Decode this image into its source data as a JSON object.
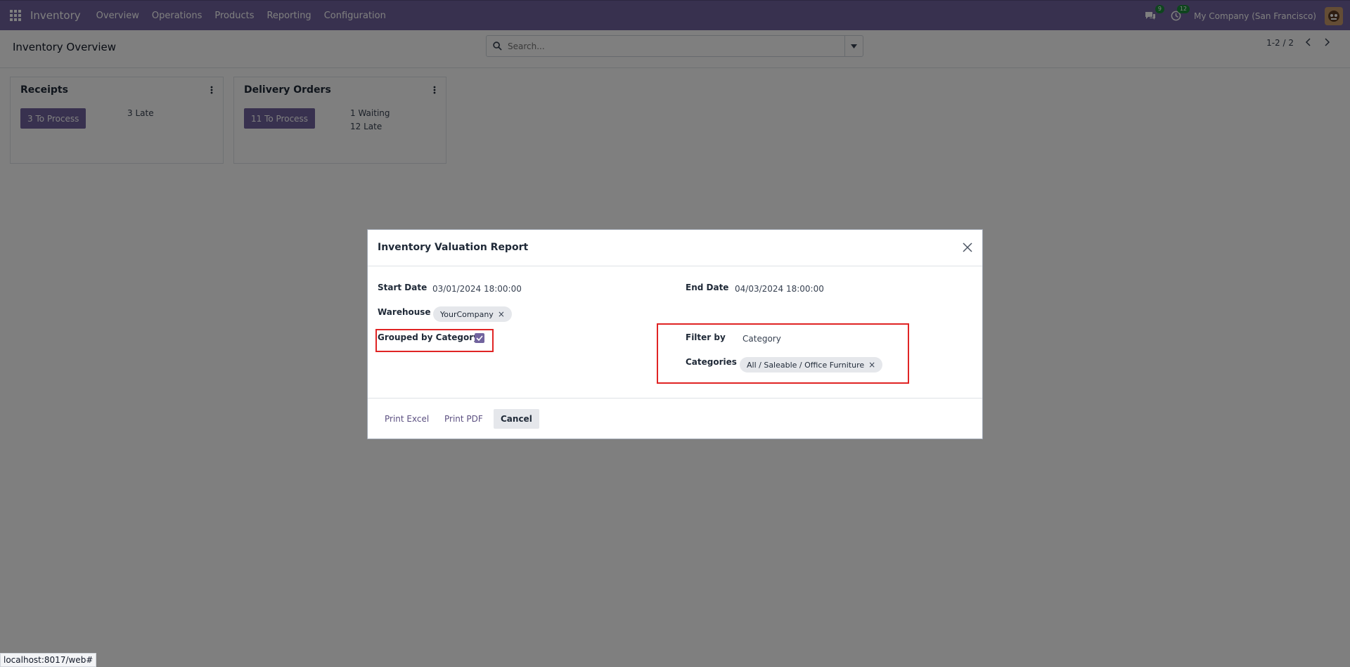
{
  "navbar": {
    "app_name": "Inventory",
    "menu": [
      "Overview",
      "Operations",
      "Products",
      "Reporting",
      "Configuration"
    ],
    "messages_count": "9",
    "activities_count": "12",
    "company": "My Company (San Francisco)",
    "colors": {
      "primary": "#71639e",
      "badge": "#1c8a3c"
    }
  },
  "control_panel": {
    "breadcrumb": "Inventory Overview",
    "search_placeholder": "Search...",
    "pager": "1-2 / 2"
  },
  "cards": [
    {
      "title": "Receipts",
      "button": "3 To Process",
      "stats": [
        "3 Late"
      ]
    },
    {
      "title": "Delivery Orders",
      "button": "11 To Process",
      "stats": [
        "1 Waiting",
        "12 Late"
      ]
    }
  ],
  "modal": {
    "title": "Inventory Valuation Report",
    "start_date_label": "Start Date",
    "start_date_value": "03/01/2024 18:00:00",
    "end_date_label": "End Date",
    "end_date_value": "04/03/2024 18:00:00",
    "warehouse_label": "Warehouse",
    "warehouse_tag": "YourCompany",
    "grouped_label": "Grouped by Category",
    "grouped_checked": true,
    "filter_label": "Filter by",
    "filter_value": "Category",
    "categories_label": "Categories",
    "categories_tag": "All / Saleable / Office Furniture",
    "buttons": {
      "print_excel": "Print Excel",
      "print_pdf": "Print PDF",
      "cancel": "Cancel"
    },
    "highlight_color": "#e02424"
  },
  "status_url": "localhost:8017/web#"
}
